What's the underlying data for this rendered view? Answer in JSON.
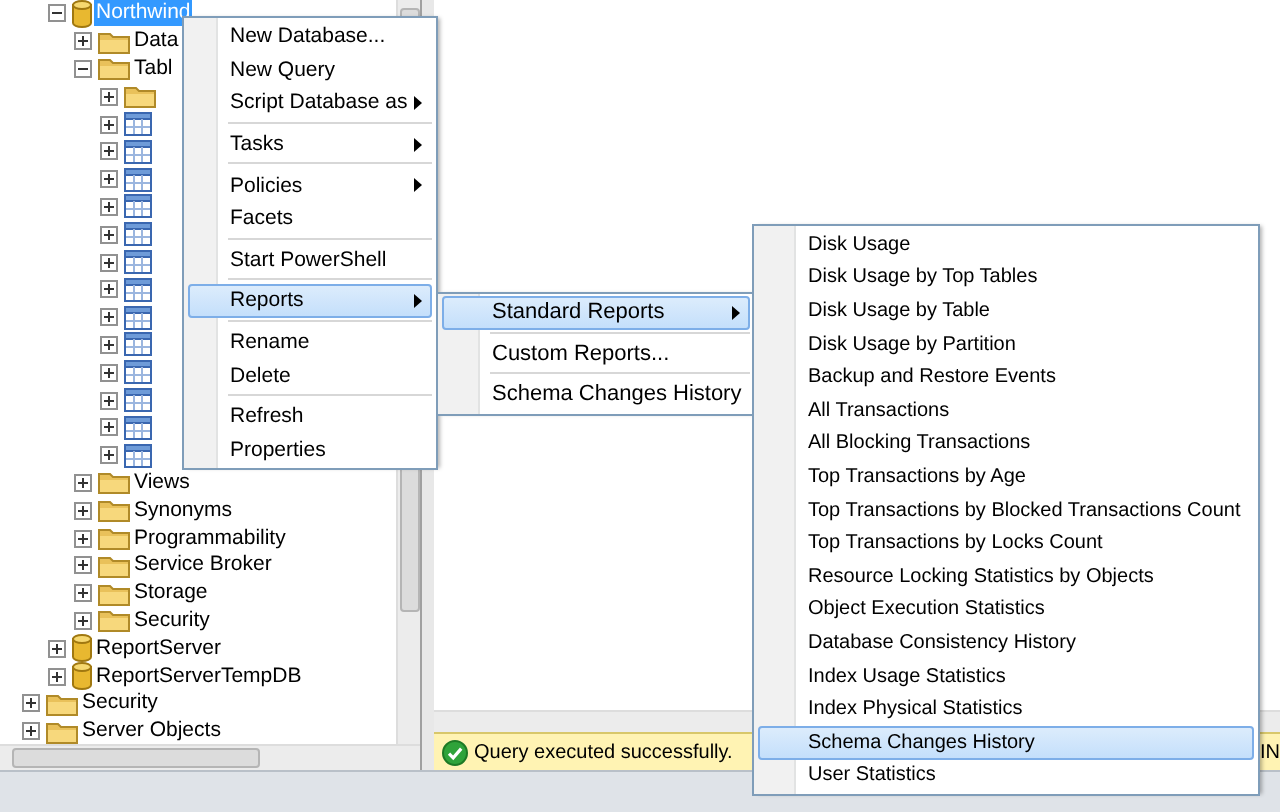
{
  "tree": {
    "database_items": [
      {
        "label": "Northwind",
        "kind": "database",
        "expanded": true,
        "selected": true,
        "children": [
          {
            "label": "Data",
            "kind": "folder",
            "expanded": false,
            "selected": false
          },
          {
            "label": "Tabl",
            "kind": "folder",
            "expanded": true,
            "selected": false,
            "children": [
              {
                "kind": "folder",
                "expanded": false
              },
              {
                "kind": "table",
                "expanded": false
              },
              {
                "kind": "table",
                "expanded": false
              },
              {
                "kind": "table",
                "expanded": false
              },
              {
                "kind": "table",
                "expanded": false
              },
              {
                "kind": "table",
                "expanded": false
              },
              {
                "kind": "table",
                "expanded": false
              },
              {
                "kind": "table",
                "expanded": false
              },
              {
                "kind": "table",
                "expanded": false
              },
              {
                "kind": "table",
                "expanded": false
              },
              {
                "kind": "table",
                "expanded": false
              },
              {
                "kind": "table",
                "expanded": false
              },
              {
                "kind": "table",
                "expanded": false
              },
              {
                "kind": "table",
                "expanded": false
              }
            ]
          },
          {
            "label": "Views",
            "kind": "folder",
            "expanded": false,
            "selected": false
          },
          {
            "label": "Synonyms",
            "kind": "folder",
            "expanded": false,
            "selected": false
          },
          {
            "label": "Programmability",
            "kind": "folder",
            "expanded": false,
            "selected": false
          },
          {
            "label": "Service Broker",
            "kind": "folder",
            "expanded": false,
            "selected": false
          },
          {
            "label": "Storage",
            "kind": "folder",
            "expanded": false,
            "selected": false
          },
          {
            "label": "Security",
            "kind": "folder",
            "expanded": false,
            "selected": false
          }
        ]
      },
      {
        "label": "ReportServer",
        "kind": "database",
        "expanded": false,
        "selected": false
      },
      {
        "label": "ReportServerTempDB",
        "kind": "database",
        "expanded": false,
        "selected": false
      }
    ],
    "server_items": [
      {
        "label": "Security",
        "kind": "folder",
        "expanded": false,
        "selected": false
      },
      {
        "label": "Server Objects",
        "kind": "folder",
        "expanded": false,
        "selected": false
      }
    ]
  },
  "context_menu": {
    "items": [
      {
        "kind": "item",
        "label": "New Database...",
        "has_submenu": false,
        "selected": false
      },
      {
        "kind": "item",
        "label": "New Query",
        "has_submenu": false,
        "selected": false
      },
      {
        "kind": "item",
        "label": "Script Database as",
        "has_submenu": true,
        "selected": false
      },
      {
        "kind": "separator"
      },
      {
        "kind": "item",
        "label": "Tasks",
        "has_submenu": true,
        "selected": false
      },
      {
        "kind": "separator"
      },
      {
        "kind": "item",
        "label": "Policies",
        "has_submenu": true,
        "selected": false
      },
      {
        "kind": "item",
        "label": "Facets",
        "has_submenu": false,
        "selected": false
      },
      {
        "kind": "separator"
      },
      {
        "kind": "item",
        "label": "Start PowerShell",
        "has_submenu": false,
        "selected": false
      },
      {
        "kind": "separator"
      },
      {
        "kind": "item",
        "label": "Reports",
        "has_submenu": true,
        "selected": true
      },
      {
        "kind": "separator"
      },
      {
        "kind": "item",
        "label": "Rename",
        "has_submenu": false,
        "selected": false
      },
      {
        "kind": "item",
        "label": "Delete",
        "has_submenu": false,
        "selected": false
      },
      {
        "kind": "separator"
      },
      {
        "kind": "item",
        "label": "Refresh",
        "has_submenu": false,
        "selected": false
      },
      {
        "kind": "item",
        "label": "Properties",
        "has_submenu": false,
        "selected": false
      }
    ]
  },
  "reports_menu": {
    "items": [
      {
        "kind": "item",
        "label": "Standard Reports",
        "has_submenu": true,
        "selected": true
      },
      {
        "kind": "separator"
      },
      {
        "kind": "item",
        "label": "Custom Reports...",
        "has_submenu": false,
        "selected": false
      },
      {
        "kind": "separator"
      },
      {
        "kind": "item",
        "label": "Schema Changes History",
        "has_submenu": false,
        "selected": false
      }
    ]
  },
  "standard_reports_menu": {
    "items": [
      {
        "kind": "item",
        "label": "Disk Usage",
        "has_submenu": false,
        "selected": false
      },
      {
        "kind": "item",
        "label": "Disk Usage by Top Tables",
        "has_submenu": false,
        "selected": false
      },
      {
        "kind": "item",
        "label": "Disk Usage by Table",
        "has_submenu": false,
        "selected": false
      },
      {
        "kind": "item",
        "label": "Disk Usage by Partition",
        "has_submenu": false,
        "selected": false
      },
      {
        "kind": "item",
        "label": "Backup and Restore Events",
        "has_submenu": false,
        "selected": false
      },
      {
        "kind": "item",
        "label": "All Transactions",
        "has_submenu": false,
        "selected": false
      },
      {
        "kind": "item",
        "label": "All Blocking Transactions",
        "has_submenu": false,
        "selected": false
      },
      {
        "kind": "item",
        "label": "Top Transactions by Age",
        "has_submenu": false,
        "selected": false
      },
      {
        "kind": "item",
        "label": "Top Transactions by Blocked Transactions Count",
        "has_submenu": false,
        "selected": false
      },
      {
        "kind": "item",
        "label": "Top Transactions by Locks Count",
        "has_submenu": false,
        "selected": false
      },
      {
        "kind": "item",
        "label": "Resource Locking Statistics by Objects",
        "has_submenu": false,
        "selected": false
      },
      {
        "kind": "item",
        "label": "Object Execution Statistics",
        "has_submenu": false,
        "selected": false
      },
      {
        "kind": "item",
        "label": "Database Consistency History",
        "has_submenu": false,
        "selected": false
      },
      {
        "kind": "item",
        "label": "Index Usage Statistics",
        "has_submenu": false,
        "selected": false
      },
      {
        "kind": "item",
        "label": "Index Physical Statistics",
        "has_submenu": false,
        "selected": false
      },
      {
        "kind": "item",
        "label": "Schema Changes History",
        "has_submenu": false,
        "selected": true
      },
      {
        "kind": "item",
        "label": "User Statistics",
        "has_submenu": false,
        "selected": false
      }
    ]
  },
  "status_bar": {
    "message": "Query executed successfully.",
    "column_2": "IN"
  }
}
